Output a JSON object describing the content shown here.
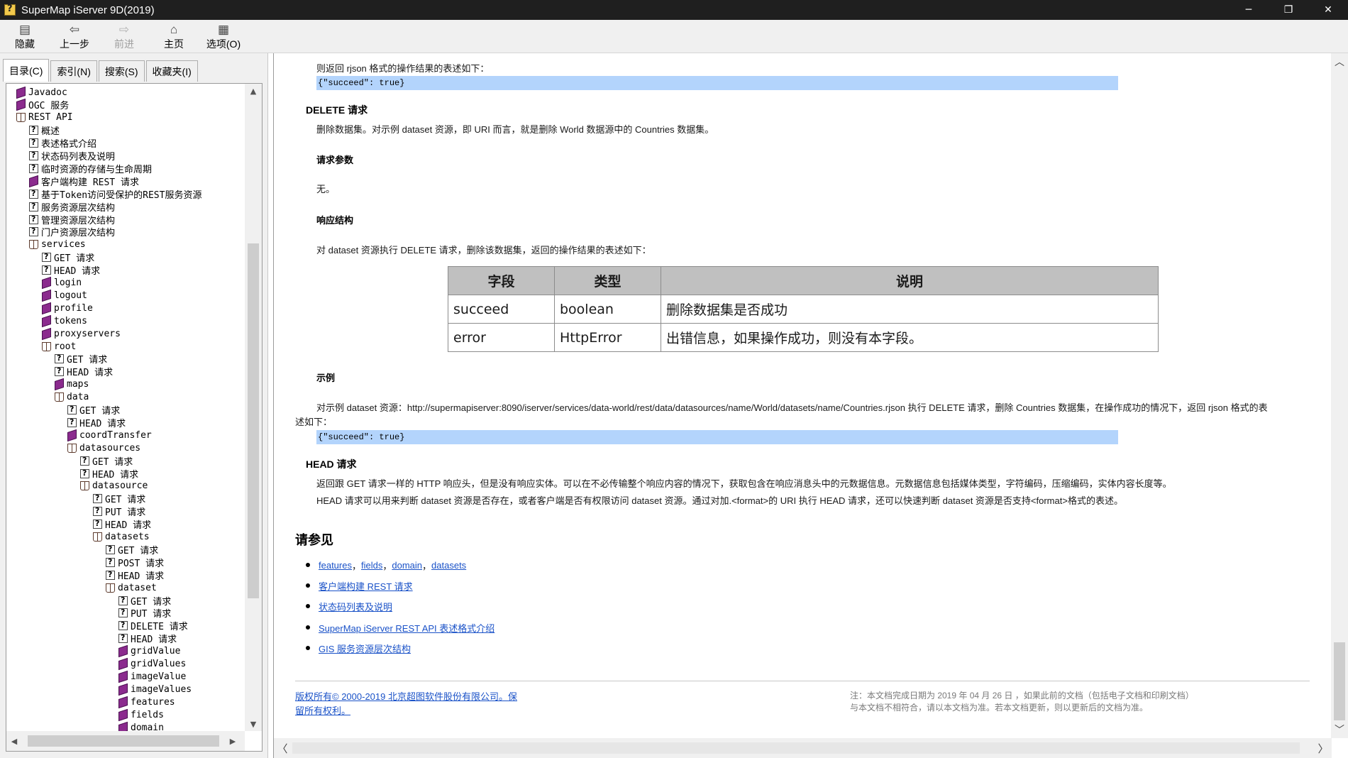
{
  "window": {
    "title": "SuperMap iServer 9D(2019)",
    "minimize": "─",
    "restore": "❐",
    "close": "✕"
  },
  "toolbar": {
    "buttons": [
      {
        "label": "隐藏",
        "icon": "hide-icon",
        "glyph": "▤",
        "enabled": true
      },
      {
        "label": "上一步",
        "icon": "back-arrow-icon",
        "glyph": "⇦",
        "enabled": true
      },
      {
        "label": "前进",
        "icon": "forward-arrow-icon",
        "glyph": "⇨",
        "enabled": false
      },
      {
        "label": "主页",
        "icon": "home-icon",
        "glyph": "⌂",
        "enabled": true
      },
      {
        "label": "选项(O)",
        "icon": "options-icon",
        "glyph": "▦",
        "enabled": true
      }
    ]
  },
  "tabs": [
    "目录(C)",
    "索引(N)",
    "搜索(S)",
    "收藏夹(I)"
  ],
  "tree": [
    {
      "label": "Javadoc",
      "type": "book",
      "depth": 1
    },
    {
      "label": "OGC 服务",
      "type": "book",
      "depth": 1
    },
    {
      "label": "REST API",
      "type": "book-open",
      "depth": 1
    },
    {
      "label": "概述",
      "type": "page",
      "depth": 2
    },
    {
      "label": "表述格式介绍",
      "type": "page",
      "depth": 2
    },
    {
      "label": "状态码列表及说明",
      "type": "page",
      "depth": 2
    },
    {
      "label": "临时资源的存储与生命周期",
      "type": "page",
      "depth": 2
    },
    {
      "label": "客户端构建 REST 请求",
      "type": "book",
      "depth": 2
    },
    {
      "label": "基于Token访问受保护的REST服务资源",
      "type": "page",
      "depth": 2
    },
    {
      "label": "服务资源层次结构",
      "type": "page",
      "depth": 2
    },
    {
      "label": "管理资源层次结构",
      "type": "page",
      "depth": 2
    },
    {
      "label": "门户资源层次结构",
      "type": "page",
      "depth": 2
    },
    {
      "label": "services",
      "type": "book-open",
      "depth": 2
    },
    {
      "label": "GET 请求",
      "type": "page",
      "depth": 3
    },
    {
      "label": "HEAD 请求",
      "type": "page",
      "depth": 3
    },
    {
      "label": "login",
      "type": "book",
      "depth": 3
    },
    {
      "label": "logout",
      "type": "book",
      "depth": 3
    },
    {
      "label": "profile",
      "type": "book",
      "depth": 3
    },
    {
      "label": "tokens",
      "type": "book",
      "depth": 3
    },
    {
      "label": "proxyservers",
      "type": "book",
      "depth": 3
    },
    {
      "label": "root",
      "type": "book-open",
      "depth": 3
    },
    {
      "label": "GET 请求",
      "type": "page",
      "depth": 4
    },
    {
      "label": "HEAD 请求",
      "type": "page",
      "depth": 4
    },
    {
      "label": "maps",
      "type": "book",
      "depth": 4
    },
    {
      "label": "data",
      "type": "book-open",
      "depth": 4
    },
    {
      "label": "GET 请求",
      "type": "page",
      "depth": 5
    },
    {
      "label": "HEAD 请求",
      "type": "page",
      "depth": 5
    },
    {
      "label": "coordTransfer",
      "type": "book",
      "depth": 5
    },
    {
      "label": "datasources",
      "type": "book-open",
      "depth": 5
    },
    {
      "label": "GET 请求",
      "type": "page",
      "depth": 6
    },
    {
      "label": "HEAD 请求",
      "type": "page",
      "depth": 6
    },
    {
      "label": "datasource",
      "type": "book-open",
      "depth": 6
    },
    {
      "label": "GET 请求",
      "type": "page",
      "depth": 7
    },
    {
      "label": "PUT 请求",
      "type": "page",
      "depth": 7
    },
    {
      "label": "HEAD 请求",
      "type": "page",
      "depth": 7
    },
    {
      "label": "datasets",
      "type": "book-open",
      "depth": 7
    },
    {
      "label": "GET 请求",
      "type": "page",
      "depth": 8
    },
    {
      "label": "POST 请求",
      "type": "page",
      "depth": 8
    },
    {
      "label": "HEAD 请求",
      "type": "page",
      "depth": 8
    },
    {
      "label": "dataset",
      "type": "book-open",
      "depth": 8
    },
    {
      "label": "GET 请求",
      "type": "page",
      "depth": 9
    },
    {
      "label": "PUT 请求",
      "type": "page",
      "depth": 9
    },
    {
      "label": "DELETE 请求",
      "type": "page",
      "depth": 9
    },
    {
      "label": "HEAD 请求",
      "type": "page",
      "depth": 9
    },
    {
      "label": "gridValue",
      "type": "book",
      "depth": 9
    },
    {
      "label": "gridValues",
      "type": "book",
      "depth": 9
    },
    {
      "label": "imageValue",
      "type": "book",
      "depth": 9
    },
    {
      "label": "imageValues",
      "type": "book",
      "depth": 9
    },
    {
      "label": "features",
      "type": "book",
      "depth": 9
    },
    {
      "label": "fields",
      "type": "book",
      "depth": 9
    },
    {
      "label": "domain",
      "type": "book",
      "depth": 9
    }
  ],
  "content": {
    "intro_rjson": "则返回 rjson 格式的操作结果的表述如下：",
    "code1": "{\"succeed\": true}",
    "delete_heading": "DELETE 请求",
    "delete_desc": "删除数据集。对示例 dataset 资源，即 URI 而言，就是删除 World 数据源中的 Countries 数据集。",
    "params_heading": "请求参数",
    "params_none": "无。",
    "response_heading": "响应结构",
    "response_desc": "对 dataset 资源执行 DELETE 请求，删除该数据集，返回的操作结果的表述如下：",
    "table": {
      "headers": [
        "字段",
        "类型",
        "说明"
      ],
      "rows": [
        [
          "succeed",
          "boolean",
          "删除数据集是否成功"
        ],
        [
          "error",
          "HttpError",
          "出错信息，如果操作成功，则没有本字段。"
        ]
      ]
    },
    "example_heading": "示例",
    "example_line1": "对示例 dataset 资源：http://supermapiserver:8090/iserver/services/data-world/rest/data/datasources/name/World/datasets/name/Countries.rjson 执行 DELETE 请求，删除 Countries 数据集，在操作成功的情况下，返回 rjson 格式的表",
    "example_line2": "述如下：",
    "code2": "{\"succeed\": true}",
    "head_heading": "HEAD 请求",
    "head_line1": "返回跟 GET 请求一样的 HTTP 响应头，但是没有响应实体。可以在不必传输整个响应内容的情况下，获取包含在响应消息头中的元数据信息。元数据信息包括媒体类型，字符编码，压缩编码，实体内容长度等。",
    "head_line2": "HEAD 请求可以用来判断 dataset 资源是否存在，或者客户端是否有权限访问 dataset 资源。通过对加.<format>的 URI 执行 HEAD 请求，还可以快速判断 dataset 资源是否支持<format>格式的表述。",
    "see_also_heading": "请参见",
    "see_also_first": {
      "links": [
        "features",
        "fields",
        "domain",
        "datasets"
      ],
      "sep1": "，",
      "sep2": "，",
      "sep3": "，"
    },
    "see_also": [
      "客户端构建 REST 请求",
      "状态码列表及说明",
      "SuperMap iServer REST API 表述格式介绍",
      "GIS 服务资源层次结构"
    ],
    "copyright": "版权所有© 2000-2019 北京超图软件股份有限公司。保留所有权利。",
    "note": "注：本文档完成日期为 2019 年 04 月 26 日 ，如果此前的文档（包括电子文档和印刷文档）与本文档不相符合，请以本文档为准。若本文档更新，则以更新后的文档为准。"
  }
}
